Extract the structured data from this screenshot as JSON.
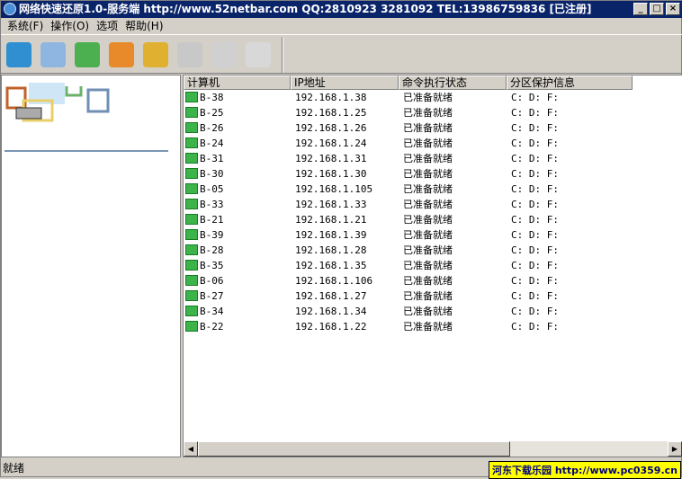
{
  "title": "网络快速还原1.0-服务端 http://www.52netbar.com QQ:2810923 3281092 TEL:13986759836 [已注册]",
  "window_buttons": {
    "minimize": "_",
    "maximize": "□",
    "close": "×"
  },
  "menu": [
    "系统(F)",
    "操作(O)",
    "选项",
    "帮助(H)"
  ],
  "toolbar": [
    {
      "icon": "computers-icon",
      "color": "#2f8fd0"
    },
    {
      "icon": "windows-icon",
      "color": "#8fb6e0"
    },
    {
      "icon": "green-board-icon",
      "color": "#4caf50"
    },
    {
      "icon": "users-icon",
      "color": "#e88a2a"
    },
    {
      "icon": "card-icon",
      "color": "#e0b030"
    },
    {
      "icon": "globe-icon",
      "color": "#c8c8c8"
    },
    {
      "icon": "chart-icon",
      "color": "#d0d0d0"
    },
    {
      "icon": "window-icon",
      "color": "#d8d8d8"
    }
  ],
  "columns": [
    "计算机",
    "IP地址",
    "命令执行状态",
    "分区保护信息"
  ],
  "rows": [
    [
      "B-38",
      "192.168.1.38",
      "已准备就绪",
      "C: D: F:"
    ],
    [
      "B-25",
      "192.168.1.25",
      "已准备就绪",
      "C: D: F:"
    ],
    [
      "B-26",
      "192.168.1.26",
      "已准备就绪",
      "C: D: F:"
    ],
    [
      "B-24",
      "192.168.1.24",
      "已准备就绪",
      "C: D: F:"
    ],
    [
      "B-31",
      "192.168.1.31",
      "已准备就绪",
      "C: D: F:"
    ],
    [
      "B-30",
      "192.168.1.30",
      "已准备就绪",
      "C: D: F:"
    ],
    [
      "B-05",
      "192.168.1.105",
      "已准备就绪",
      "C: D: F:"
    ],
    [
      "B-33",
      "192.168.1.33",
      "已准备就绪",
      "C: D: F:"
    ],
    [
      "B-21",
      "192.168.1.21",
      "已准备就绪",
      "C: D: F:"
    ],
    [
      "B-39",
      "192.168.1.39",
      "已准备就绪",
      "C: D: F:"
    ],
    [
      "B-28",
      "192.168.1.28",
      "已准备就绪",
      "C: D: F:"
    ],
    [
      "B-35",
      "192.168.1.35",
      "已准备就绪",
      "C: D: F:"
    ],
    [
      "B-06",
      "192.168.1.106",
      "已准备就绪",
      "C: D: F:"
    ],
    [
      "B-27",
      "192.168.1.27",
      "已准备就绪",
      "C: D: F:"
    ],
    [
      "B-34",
      "192.168.1.34",
      "已准备就绪",
      "C: D: F:"
    ],
    [
      "B-22",
      "192.168.1.22",
      "已准备就绪",
      "C: D: F:"
    ]
  ],
  "scroll": {
    "left": "◀",
    "right": "▶"
  },
  "status": "就绪",
  "watermark": "河东下载乐园 http://www.pc0359.cn"
}
